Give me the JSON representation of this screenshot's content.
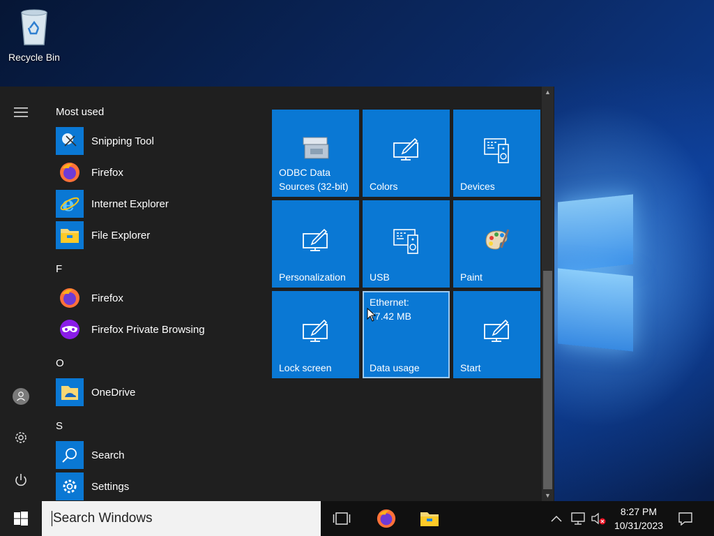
{
  "desktop": {
    "icons": [
      {
        "label": "Recycle Bin",
        "icon": "recycle-bin-icon"
      }
    ]
  },
  "start_menu": {
    "rail": {
      "menu_icon": "hamburger-icon",
      "account_icon": "user-icon",
      "settings_icon": "gear-icon",
      "power_icon": "power-icon"
    },
    "groups": [
      {
        "header": "Most used",
        "items": [
          {
            "label": "Snipping Tool",
            "icon": "snipping-tool-icon"
          },
          {
            "label": "Firefox",
            "icon": "firefox-icon"
          },
          {
            "label": "Internet Explorer",
            "icon": "internet-explorer-icon"
          },
          {
            "label": "File Explorer",
            "icon": "folder-icon"
          }
        ]
      },
      {
        "header": "F",
        "items": [
          {
            "label": "Firefox",
            "icon": "firefox-icon"
          },
          {
            "label": "Firefox Private Browsing",
            "icon": "firefox-private-icon"
          }
        ]
      },
      {
        "header": "O",
        "items": [
          {
            "label": "OneDrive",
            "icon": "onedrive-folder-icon"
          }
        ]
      },
      {
        "header": "S",
        "items": [
          {
            "label": "Search",
            "icon": "search-icon"
          },
          {
            "label": "Settings",
            "icon": "gear-icon"
          }
        ]
      }
    ],
    "tiles": [
      {
        "label": "ODBC Data Sources (32-bit)",
        "icon": "odbc-icon"
      },
      {
        "label": "Colors",
        "icon": "pen-monitor-icon"
      },
      {
        "label": "Devices",
        "icon": "keyboard-speaker-icon"
      },
      {
        "label": "Personalization",
        "icon": "pen-monitor-icon"
      },
      {
        "label": "USB",
        "icon": "keyboard-speaker-icon"
      },
      {
        "label": "Paint",
        "icon": "palette-icon"
      },
      {
        "label": "Lock screen",
        "icon": "pen-monitor-icon"
      },
      {
        "label": "Data usage",
        "line1": "Ethernet:",
        "line2": "77.42 MB"
      },
      {
        "label": "Start",
        "icon": "pen-monitor-icon"
      }
    ]
  },
  "taskbar": {
    "search_placeholder": "Search Windows",
    "time": "8:27 PM",
    "date": "10/31/2023",
    "pinned": [
      "task-view-icon",
      "firefox-icon",
      "file-explorer-icon"
    ],
    "tray": [
      "chevron-up-icon",
      "network-icon",
      "volume-muted-icon",
      "notification-icon"
    ]
  },
  "colors": {
    "accent": "#0a78d4",
    "start_bg": "#1f1f1f",
    "taskbar_bg": "#101010"
  }
}
